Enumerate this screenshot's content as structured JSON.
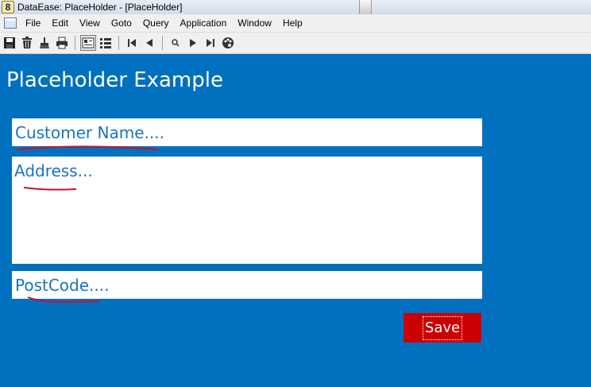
{
  "window": {
    "app_icon_glyph": "8",
    "title": "DataEase: PlaceHolder - [PlaceHolder]"
  },
  "menu": {
    "items": [
      "File",
      "Edit",
      "View",
      "Goto",
      "Query",
      "Application",
      "Window",
      "Help"
    ]
  },
  "toolbar": {
    "icons": [
      "save-icon",
      "delete-icon",
      "clear-icon",
      "print-icon",
      "form-view-icon",
      "table-view-icon",
      "first-record-icon",
      "previous-record-icon",
      "search-icon",
      "next-record-icon",
      "last-record-icon",
      "palette-icon"
    ]
  },
  "form": {
    "title": "Placeholder Example",
    "customer_name_placeholder": "Customer Name....",
    "address_placeholder": "Address...",
    "postcode_placeholder": "PostCode....",
    "save_label": "Save"
  },
  "colors": {
    "background": "#0070bf",
    "field_text": "#1a73c0",
    "save_button": "#cc0000",
    "annotation": "#c8102e"
  }
}
